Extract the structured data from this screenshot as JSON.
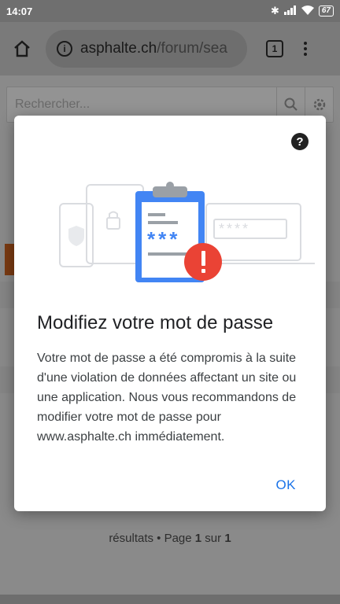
{
  "status_bar": {
    "time": "14:07",
    "battery": "67"
  },
  "toolbar": {
    "url_host": "asphalte.ch",
    "url_path": "/forum/sea",
    "tab_count": "1"
  },
  "page": {
    "search_placeholder": "Rechercher...",
    "results_prefix": "résultats • Page ",
    "results_page": "1",
    "results_mid": " sur ",
    "results_total": "1"
  },
  "dialog": {
    "title": "Modifiez votre mot de passe",
    "body": "Votre mot de passe a été compromis à la suite d'une violation de données affectant un site ou une application. Nous vous recom­mandons de modifier votre mot de passe pour www.asphalte.ch immédiatement.",
    "ok_label": "OK",
    "help_icon": "?",
    "illustration_masked_short": "***",
    "illustration_masked_long": "****"
  },
  "colors": {
    "accent": "#1a73e8",
    "alert": "#ea4335",
    "clipboard_blue": "#4285f4"
  }
}
